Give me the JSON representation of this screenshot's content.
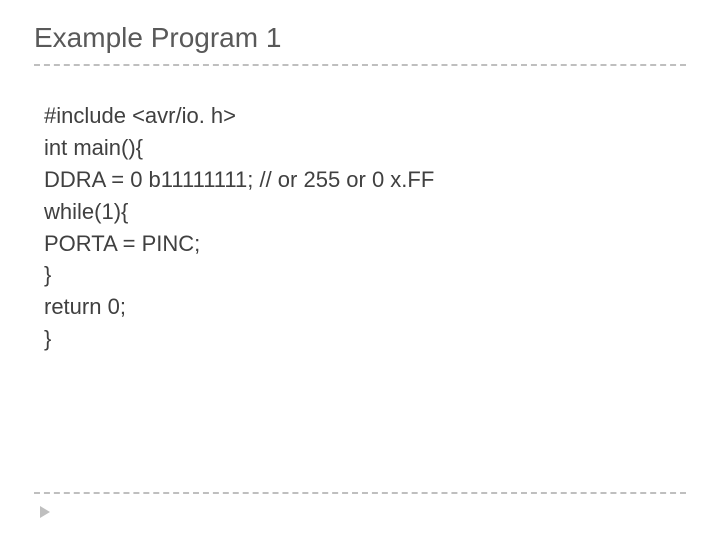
{
  "title": "Example Program 1",
  "code": {
    "l1": "#include <avr/io. h>",
    "l2": "int main(){",
    "l3": "DDRA = 0 b11111111; // or 255 or 0 x.FF",
    "l4": "while(1){",
    "l5": "PORTA = PINC;",
    "l6": "}",
    "l7": "return 0;",
    "l8": "}"
  }
}
